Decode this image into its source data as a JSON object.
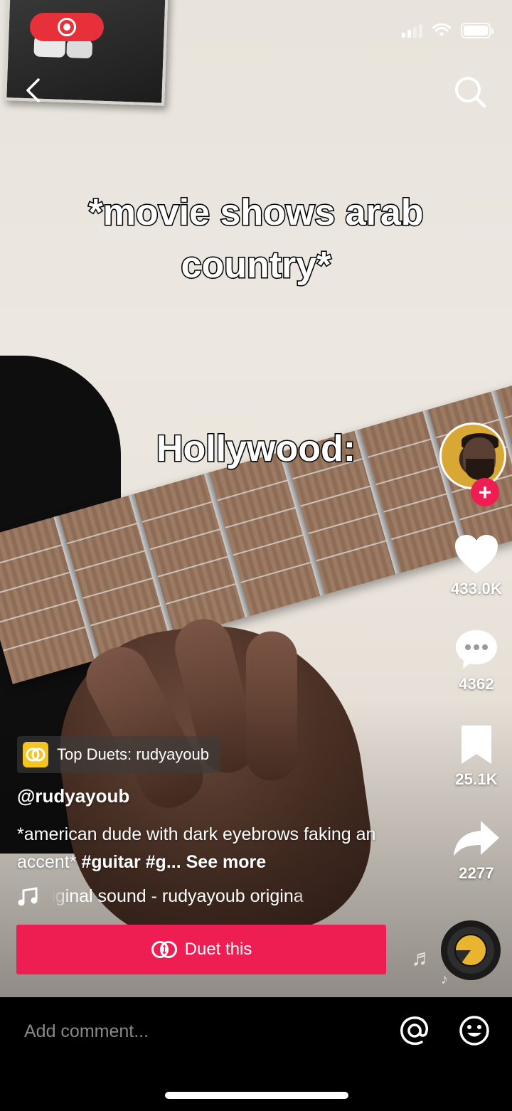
{
  "video": {
    "caption_line1": "*movie shows arab",
    "caption_line2": "country*",
    "caption_line3": "Hollywood:"
  },
  "status_bar": {
    "recording": true,
    "signal_bars": 2,
    "battery_level": 1.0
  },
  "header": {
    "back_icon": "chevron-left-icon",
    "search_icon": "search-icon"
  },
  "creator": {
    "username": "@rudyayoub",
    "follow_icon": "plus-icon"
  },
  "actions": {
    "likes": "433.0K",
    "comments": "4362",
    "saves": "25.1K",
    "shares": "2277"
  },
  "duet_chip": {
    "label": "Top Duets: rudyayoub"
  },
  "post": {
    "description": "*american dude with dark eyebrows faking an accent*",
    "hashtag_1": "#guitar",
    "hashtag_2": "#g...",
    "see_more": "See more",
    "sound": "original sound - rudyayoub    origina"
  },
  "duet_button": {
    "label": "Duet this"
  },
  "comment_bar": {
    "placeholder": "Add comment...",
    "mention_icon": "at-icon",
    "emoji_icon": "emoji-icon"
  },
  "colors": {
    "accent": "#ee1d52",
    "record": "#e8303a",
    "chip_icon": "#f4c522"
  }
}
